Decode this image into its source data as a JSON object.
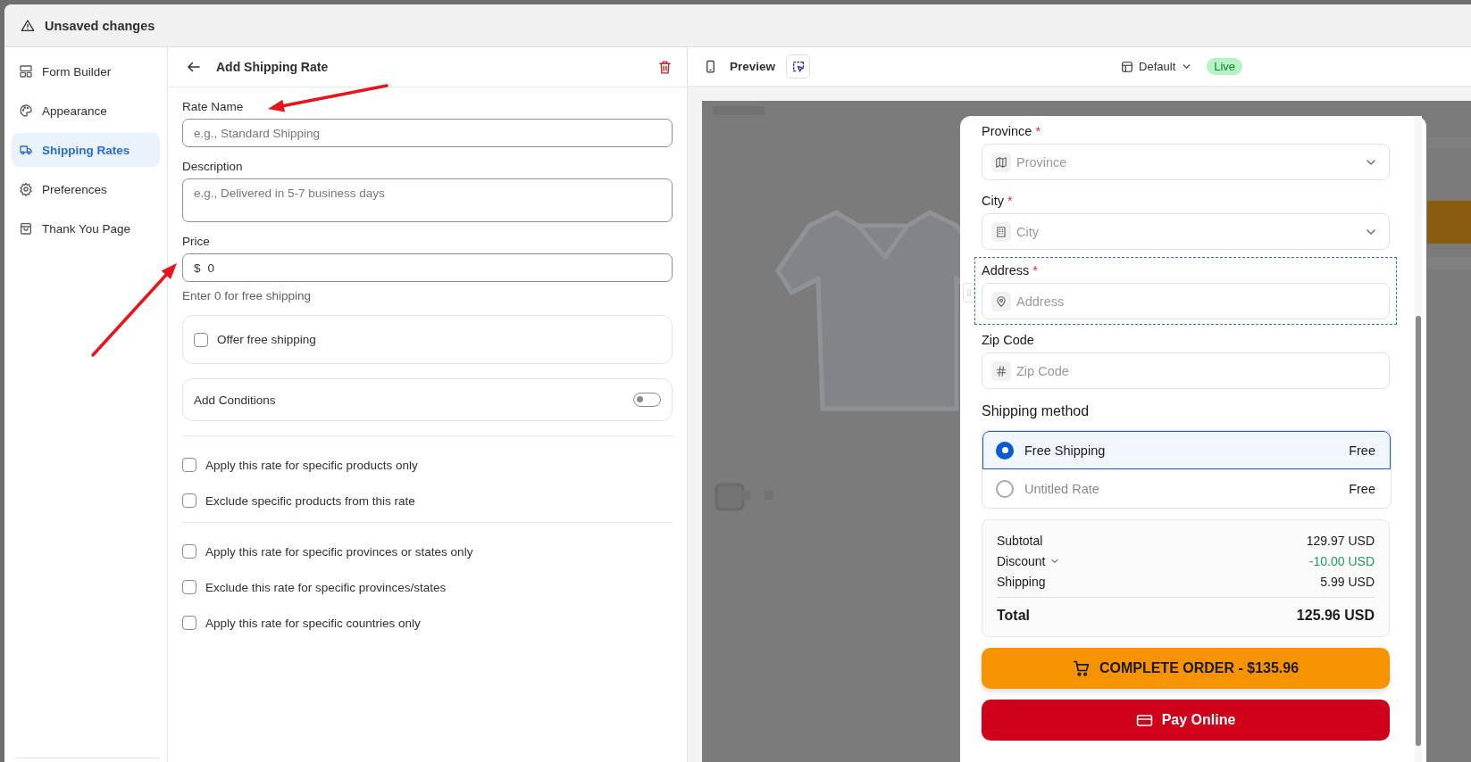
{
  "notice": {
    "text": "Unsaved changes"
  },
  "sidebar": {
    "items": [
      {
        "label": "Form Builder",
        "selected": false
      },
      {
        "label": "Appearance",
        "selected": false
      },
      {
        "label": "Shipping Rates",
        "selected": true
      },
      {
        "label": "Preferences",
        "selected": false
      },
      {
        "label": "Thank You Page",
        "selected": false
      }
    ]
  },
  "form": {
    "title": "Add Shipping Rate",
    "fields": [
      {
        "kind": "text",
        "label": "Rate Name",
        "placeholder": "e.g., Standard Shipping"
      },
      {
        "kind": "textarea",
        "label": "Description",
        "placeholder": "e.g., Delivered in 5-7 business days"
      },
      {
        "kind": "price",
        "label": "Price",
        "prefix": "$",
        "value": "0",
        "hint": "Enter 0 for free shipping"
      }
    ],
    "free_shipping": {
      "label": "Offer free shipping",
      "checked": false
    },
    "conditions": {
      "label": "Add Conditions",
      "on": false
    },
    "rule_groups": [
      [
        {
          "label": "Apply this rate for specific products only",
          "checked": false
        },
        {
          "label": "Exclude specific products from this rate",
          "checked": false
        }
      ],
      [
        {
          "label": "Apply this rate for specific provinces or states only",
          "checked": false
        },
        {
          "label": "Exclude this rate for specific provinces/states",
          "checked": false
        },
        {
          "label": "Apply this rate for specific countries only",
          "checked": false
        }
      ]
    ]
  },
  "preview": {
    "title": "Preview",
    "template": "Default",
    "badge": "Live",
    "checkout": {
      "fields": [
        {
          "kind": "select",
          "label": "Province",
          "required_mark": "*",
          "placeholder": "Province",
          "selected": false
        },
        {
          "kind": "select",
          "label": "City",
          "required_mark": "*",
          "placeholder": "City",
          "selected": false
        },
        {
          "kind": "text",
          "label": "Address",
          "required_mark": "*",
          "placeholder": "Address",
          "selected": true
        },
        {
          "kind": "text",
          "label": "Zip Code",
          "placeholder": "Zip Code",
          "selected": false
        }
      ],
      "shipping_title": "Shipping method",
      "methods": [
        {
          "name": "Free Shipping",
          "price": "Free",
          "selected": true
        },
        {
          "name": "Untitled Rate",
          "price": "Free",
          "selected": false
        }
      ],
      "summary": [
        {
          "kind": "line",
          "label": "Subtotal",
          "value": "129.97 USD"
        },
        {
          "kind": "discount",
          "label": "Discount",
          "value": "-10.00 USD"
        },
        {
          "kind": "line",
          "label": "Shipping",
          "value": "5.99 USD"
        },
        {
          "kind": "total",
          "label": "Total",
          "value": "125.96 USD"
        }
      ],
      "buttons": [
        {
          "kind": "order",
          "label": "COMPLETE ORDER - $135.96"
        },
        {
          "kind": "pay",
          "label": "Pay Online"
        }
      ]
    }
  },
  "annotations": [
    {
      "kind": "arrow"
    },
    {
      "kind": "arrow"
    }
  ]
}
